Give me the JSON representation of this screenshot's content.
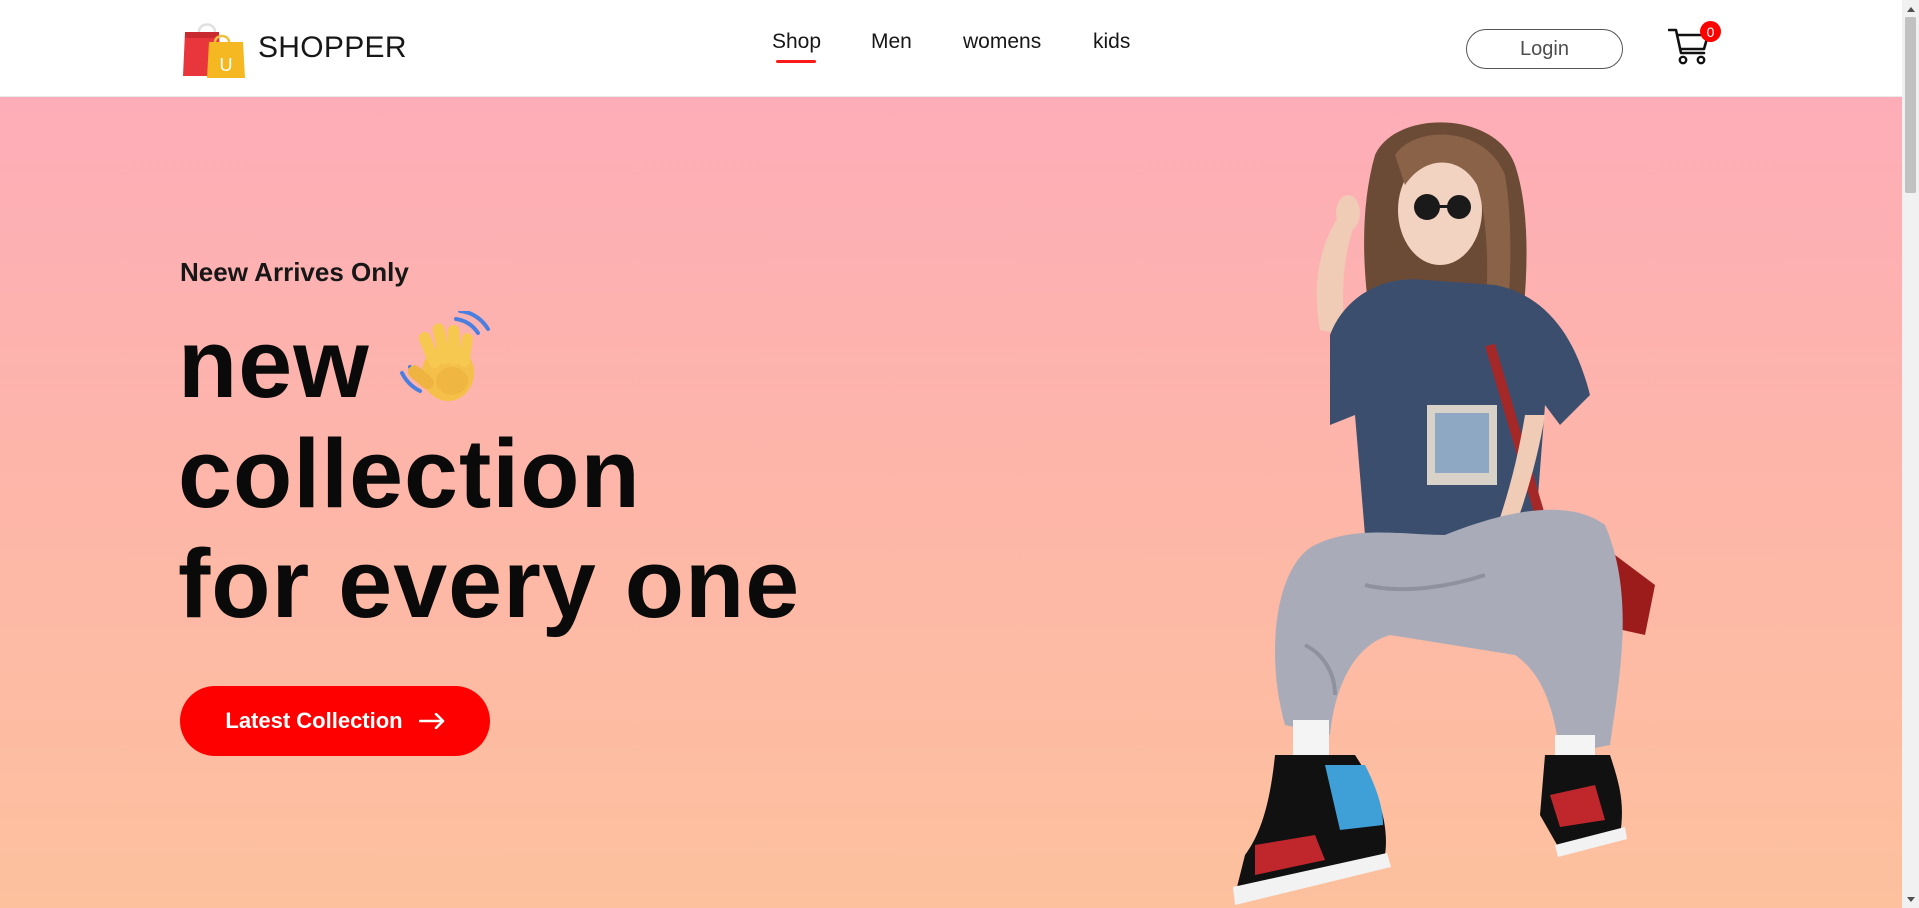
{
  "brand": {
    "name": "SHOPPER",
    "logo_letter": "U"
  },
  "nav": {
    "items": [
      {
        "label": "Shop",
        "active": true
      },
      {
        "label": "Men",
        "active": false
      },
      {
        "label": "womens",
        "active": false
      },
      {
        "label": "kids",
        "active": false
      }
    ]
  },
  "header": {
    "login_label": "Login",
    "cart_count": "0"
  },
  "hero": {
    "tagline": "Neew Arrives Only",
    "title_lines": [
      "new",
      "collection",
      "for every one"
    ],
    "cta_label": "Latest Collection",
    "cta_icon": "arrow-right-icon",
    "emoji_icon": "waving-hand-icon",
    "image_alt": "hero-model-image"
  },
  "colors": {
    "accent": "#ff0000",
    "hero_gradient_top": "#fdadb8",
    "hero_gradient_bottom": "#fdc19e",
    "text": "#0a0a0a"
  }
}
